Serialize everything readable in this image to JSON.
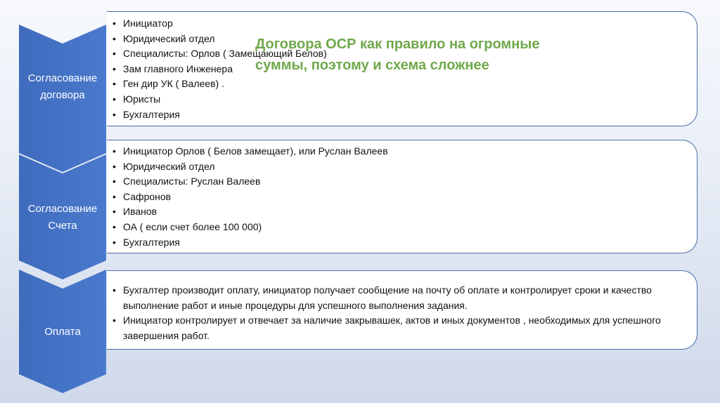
{
  "stages": [
    {
      "label": "Согласование договора",
      "items": [
        "Инициатор",
        "Юридический отдел",
        "Специалисты: Орлов ( Замещающий Белов)",
        "Зам главного Инженера",
        "Ген дир УК ( Валеев) .",
        "Юристы",
        "Бухгалтерия"
      ],
      "note": "Договора ОСР как правило на огромные суммы, поэтому и схема сложнее"
    },
    {
      "label": "Согласование Счета",
      "items": [
        "Инициатор Орлов ( Белов замещает), или Руслан Валеев",
        "Юридический отдел",
        "Специалисты: Руслан Валеев",
        "Сафронов",
        "Иванов",
        "ОА ( если счет более 100 000)",
        "Бухгалтерия"
      ]
    },
    {
      "label": "Оплата",
      "items": [
        "Бухгалтер производит оплату, инициатор получает сообщение на почту об оплате и контролирует сроки и качество выполнение работ и иные процедуры для успешного выполнения задания.",
        "Инициатор контролирует и отвечает за наличие закрывашек, актов и иных документов , необходимых для успешного завершения работ."
      ]
    }
  ],
  "colors": {
    "chevron_fill": "#4472c4",
    "panel_border": "#4a6fa8",
    "note_text": "#70a84b"
  }
}
